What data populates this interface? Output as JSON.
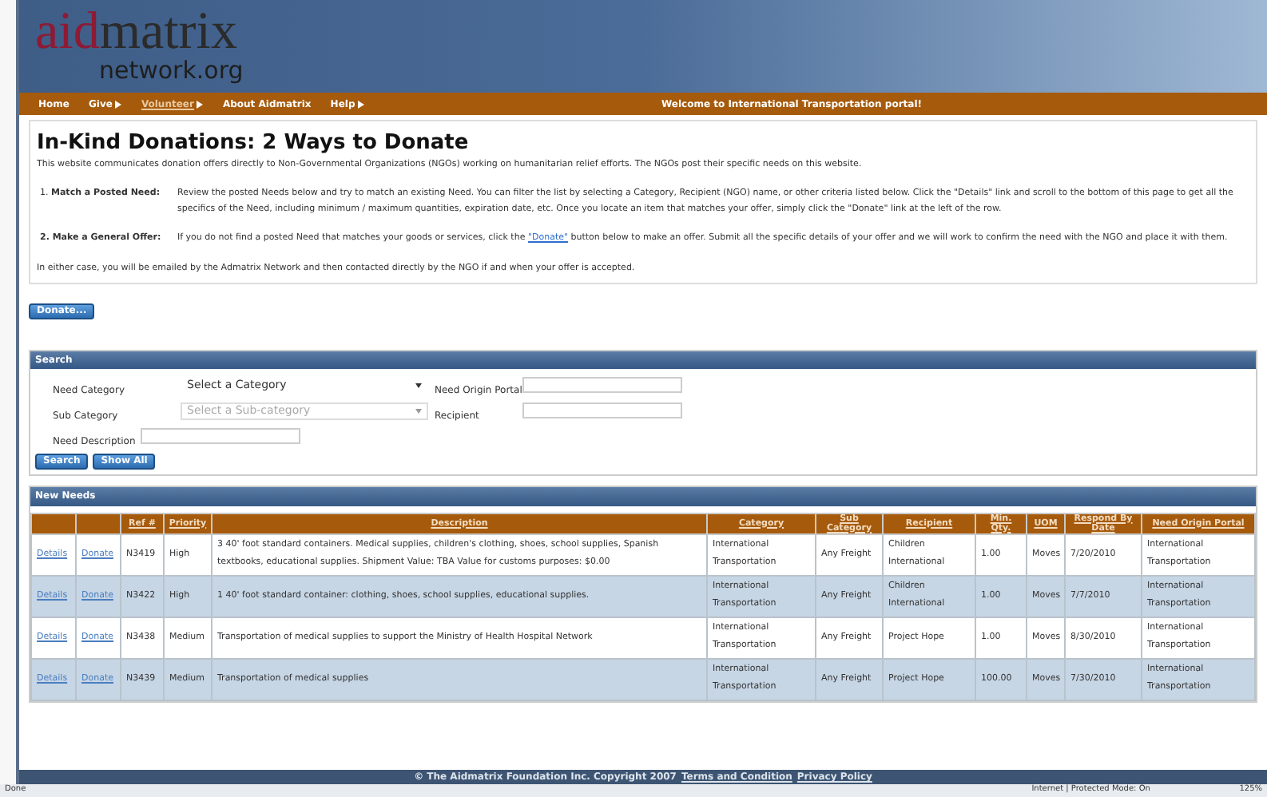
{
  "logo": {
    "part_1": "aid",
    "part_2": "matrix",
    "tagline": "network.org"
  },
  "nav": {
    "items": [
      {
        "label": "Home",
        "submenu": false,
        "selected": false
      },
      {
        "label": "Give",
        "submenu": true,
        "selected": false
      },
      {
        "label": "Volunteer",
        "submenu": true,
        "selected": true
      },
      {
        "label": "About Aidmatrix",
        "submenu": false,
        "selected": false
      },
      {
        "label": "Help",
        "submenu": true,
        "selected": false
      }
    ],
    "welcome": "Welcome to International Transportation portal!"
  },
  "intro": {
    "title": "In-Kind Donations: 2 Ways to Donate",
    "lead": "This website communicates donation offers directly to Non-Governmental Organizations (NGOs) working on humanitarian relief efforts. The NGOs post their specific needs on this website.",
    "ways": [
      {
        "label": "1. **Match a Posted Need:**",
        "text": "Review the posted Needs below and try to match an existing Need. You can filter the list by selecting a Category, Recipient (NGO) name, or other criteria listed below. Click the \"Details\" link and scroll to the bottom of this page to get all the specifics of the Need, including minimum / maximum quantities, expiration date, etc. Once you locate an item that matches your offer, simply click the \"Donate\" link at the left of the row."
      },
      {
        "label": "**2. Make a General Offer:**",
        "text_before": "If you do not find a posted Need that matches your goods or services, click the ",
        "link": "\"Donate\"",
        "text_after": " button below to make an offer. Submit all the specific details of your offer and we will work to confirm the need with the NGO and place it with them."
      }
    ],
    "closing": "In either case, you will be emailed by the Admatrix Network and then contacted directly by the NGO if and when your offer is accepted.",
    "button": "Donate..."
  },
  "search": {
    "title": "Search",
    "fields": [
      {
        "kind": "select",
        "label": "Need Category",
        "value": "Select a Category",
        "disabled": false
      },
      {
        "kind": "input",
        "label": "Need Origin Portal"
      },
      {
        "kind": "select",
        "label": "Sub Category",
        "value": "Select a Sub-category",
        "disabled": true
      },
      {
        "kind": "input",
        "label": "Recipient"
      },
      {
        "kind": "input",
        "label": "Need Description"
      }
    ],
    "buttons": [
      "Search",
      "Show All"
    ]
  },
  "needs": {
    "title": "New Needs",
    "columns": [
      "",
      "",
      "Ref #",
      "Priority",
      "Description",
      "Category",
      "Sub Category",
      "Recipient",
      "Min. Qty.",
      "UOM",
      "Respond By Date",
      "Need Origin Portal"
    ],
    "rows": [
      [
        "Details",
        "Donate",
        "N3419",
        "High",
        "3 40' foot standard containers. Medical supplies, children's clothing, shoes, school supplies, Spanish textbooks, educational supplies. Shipment Value: TBA Value for customs purposes: $0.00",
        "International Transportation",
        "Any Freight",
        "Children International",
        "1.00",
        "Moves",
        "7/20/2010",
        "International Transportation"
      ],
      [
        "Details",
        "Donate",
        "N3422",
        "High",
        "1 40' foot standard container: clothing, shoes, school supplies, educational supplies.",
        "International Transportation",
        "Any Freight",
        "Children International",
        "1.00",
        "Moves",
        "7/7/2010",
        "International Transportation"
      ],
      [
        "Details",
        "Donate",
        "N3438",
        "Medium",
        "Transportation of medical supplies to support the Ministry of Health Hospital Network",
        "International Transportation",
        "Any Freight",
        "Project Hope",
        "1.00",
        "Moves",
        "8/30/2010",
        "International Transportation"
      ],
      [
        "Details",
        "Donate",
        "N3439",
        "Medium",
        "Transportation of medical supplies",
        "International Transportation",
        "Any Freight",
        "Project Hope",
        "100.00",
        "Moves",
        "7/30/2010",
        "International Transportation"
      ]
    ]
  },
  "footer": {
    "text": "© The Aidmatrix Foundation Inc. Copyright 2007",
    "links": [
      "Terms and Condition",
      "Privacy Policy"
    ]
  },
  "status_bar": {
    "left": "Done",
    "zone": "Internet | Protected Mode: On",
    "zoom": "125%"
  }
}
